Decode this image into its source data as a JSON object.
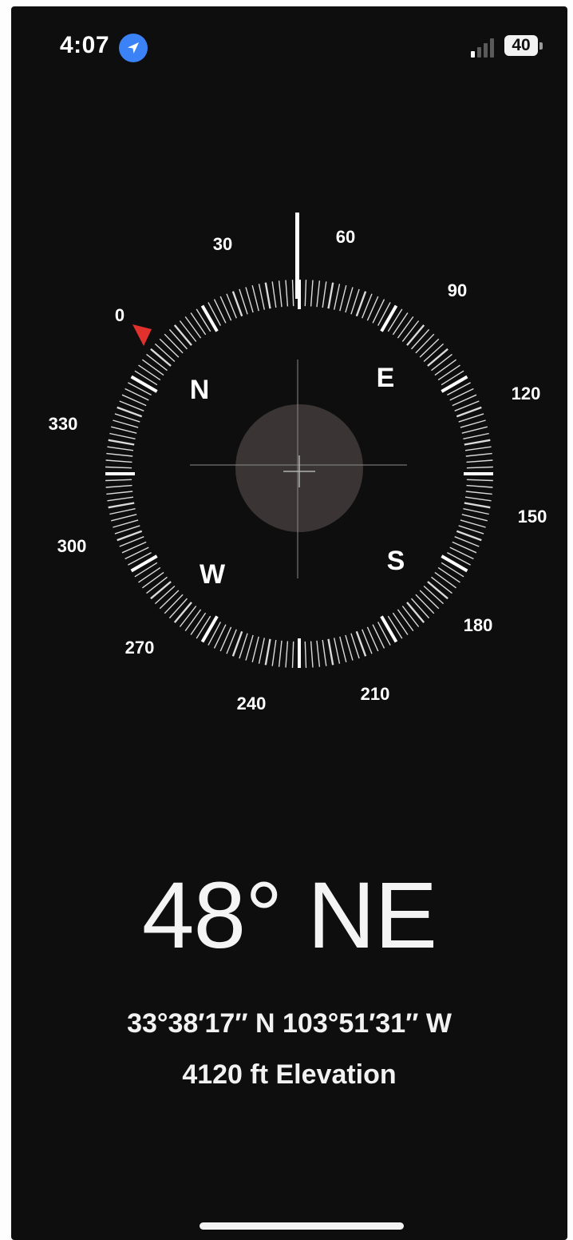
{
  "status_bar": {
    "time": "4:07",
    "location_icon": "location-arrow-icon",
    "signal_icon": "cellular-signal-icon",
    "battery_level": "40"
  },
  "compass": {
    "degree_labels": [
      "0",
      "30",
      "60",
      "90",
      "120",
      "150",
      "180",
      "210",
      "240",
      "270",
      "300",
      "330"
    ],
    "cardinal_labels": [
      "N",
      "E",
      "S",
      "W"
    ],
    "heading_marker_color": "#e0312d",
    "ring_color": "#ffffff",
    "center_circle_color": "#3a3434"
  },
  "readout": {
    "heading": "48° NE",
    "coordinates": "33°38′17″ N  103°51′31″ W",
    "elevation": "4120 ft Elevation"
  }
}
